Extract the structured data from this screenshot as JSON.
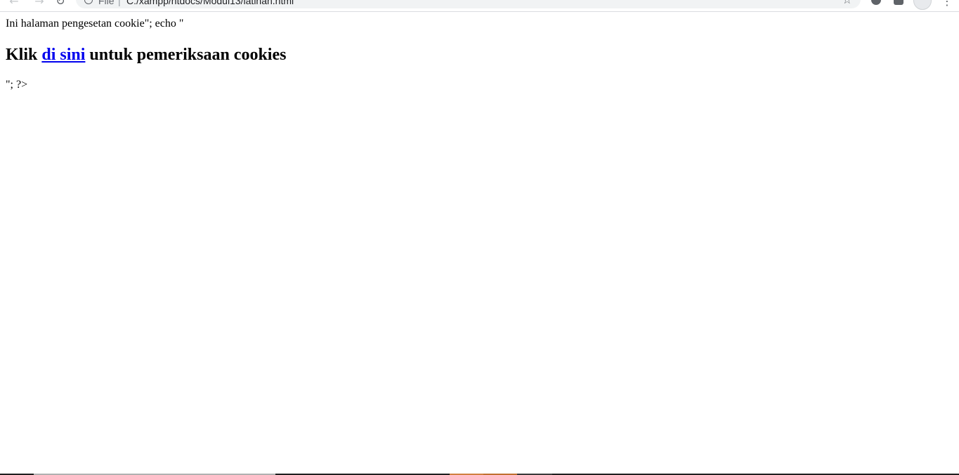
{
  "browser": {
    "scheme_label": "File",
    "url": "C:/xampp/htdocs/Modul13/latihan.html"
  },
  "page": {
    "intro_text": "Ini halaman pengesetan cookie\"; echo \"",
    "heading_prefix": "Klik ",
    "heading_link": "di sini",
    "heading_suffix": " untuk pemeriksaan cookies",
    "trailing_text": "\"; ?>"
  },
  "colors": {
    "link": "#0000ee",
    "taskbar": "#1f1f1f"
  }
}
